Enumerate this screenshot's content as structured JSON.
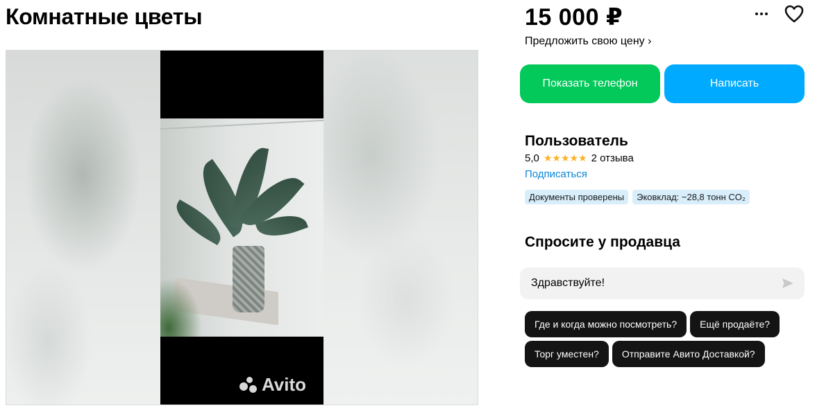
{
  "listing": {
    "title": "Комнатные цветы",
    "price": "15 000 ₽",
    "offer_link": "Предложить свою цену ›"
  },
  "actions": {
    "show_phone": "Показать телефон",
    "write": "Написать",
    "more_icon": "more-horizontal-icon",
    "favorite_icon": "heart-icon"
  },
  "gallery": {
    "watermark": "Avito"
  },
  "seller": {
    "name": "Пользователь",
    "rating": "5,0",
    "stars": "★★★★★",
    "reviews": "2 отзыва",
    "subscribe": "Подписаться",
    "badges": [
      "Документы проверены",
      "Эковклад: −28,8 тонн CO₂"
    ]
  },
  "ask": {
    "title": "Спросите у продавца",
    "message_value": "Здравствуйте!",
    "quick_questions": [
      "Где и когда можно посмотреть?",
      "Ещё продаёте?",
      "Торг уместен?",
      "Отправите Авито Доставкой?"
    ]
  },
  "colors": {
    "phone_button": "#02c95a",
    "write_button": "#00aaff",
    "link": "#0a86d6",
    "badge_bg": "#d8eefb",
    "star": "#ffb021",
    "chip_bg": "#141414"
  }
}
